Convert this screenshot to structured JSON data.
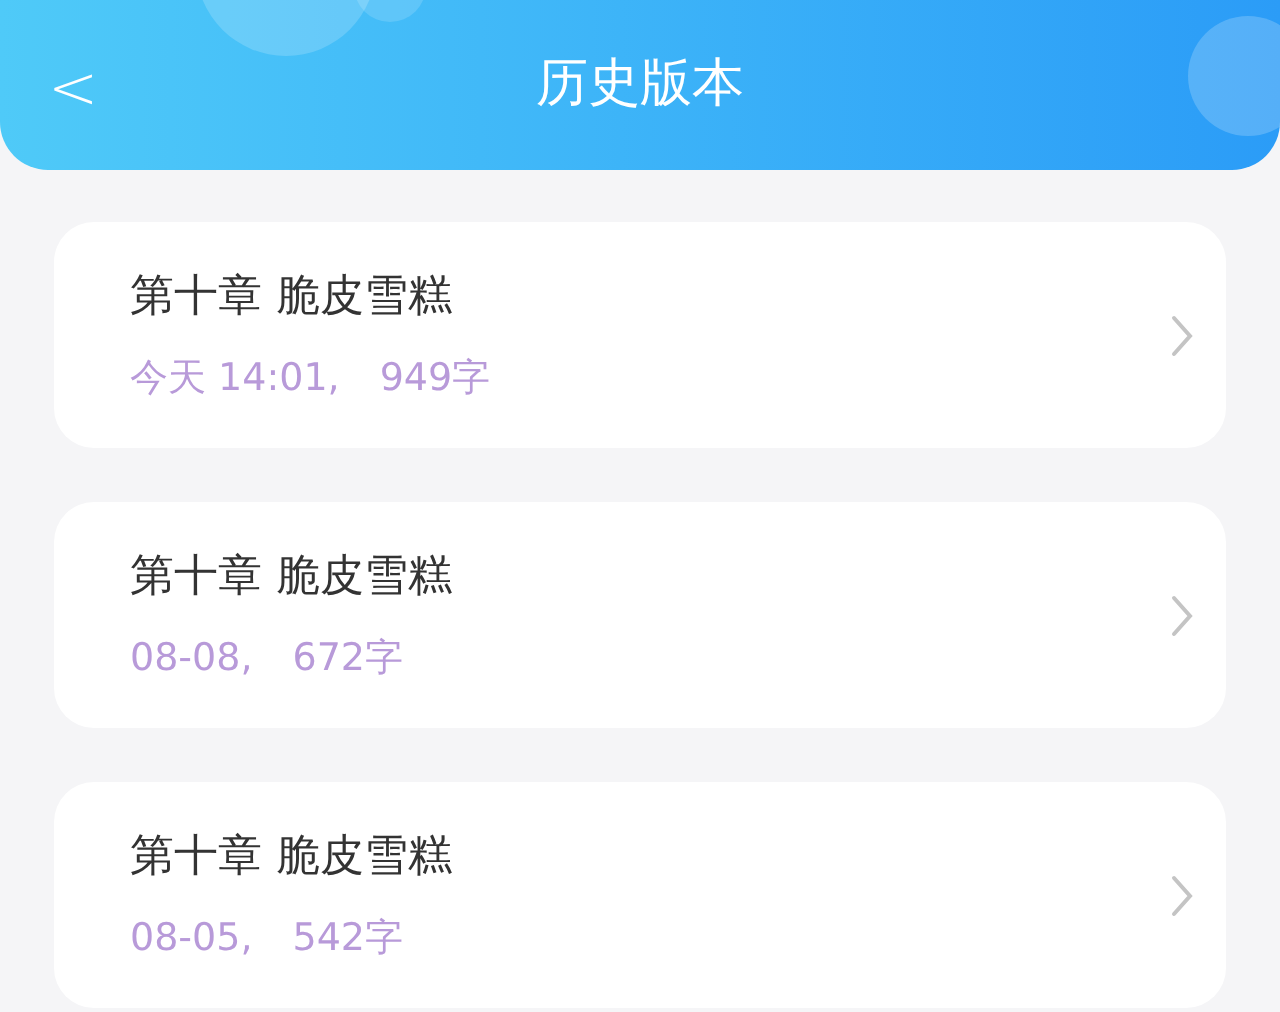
{
  "header": {
    "back": "<",
    "title": "历史版本"
  },
  "versions": [
    {
      "title": "第十章 脆皮雪糕",
      "time": "今天 14:01,",
      "count": "949字"
    },
    {
      "title": "第十章 脆皮雪糕",
      "time": "08-08,",
      "count": "672字"
    },
    {
      "title": "第十章 脆皮雪糕",
      "time": "08-05,",
      "count": "542字"
    }
  ]
}
